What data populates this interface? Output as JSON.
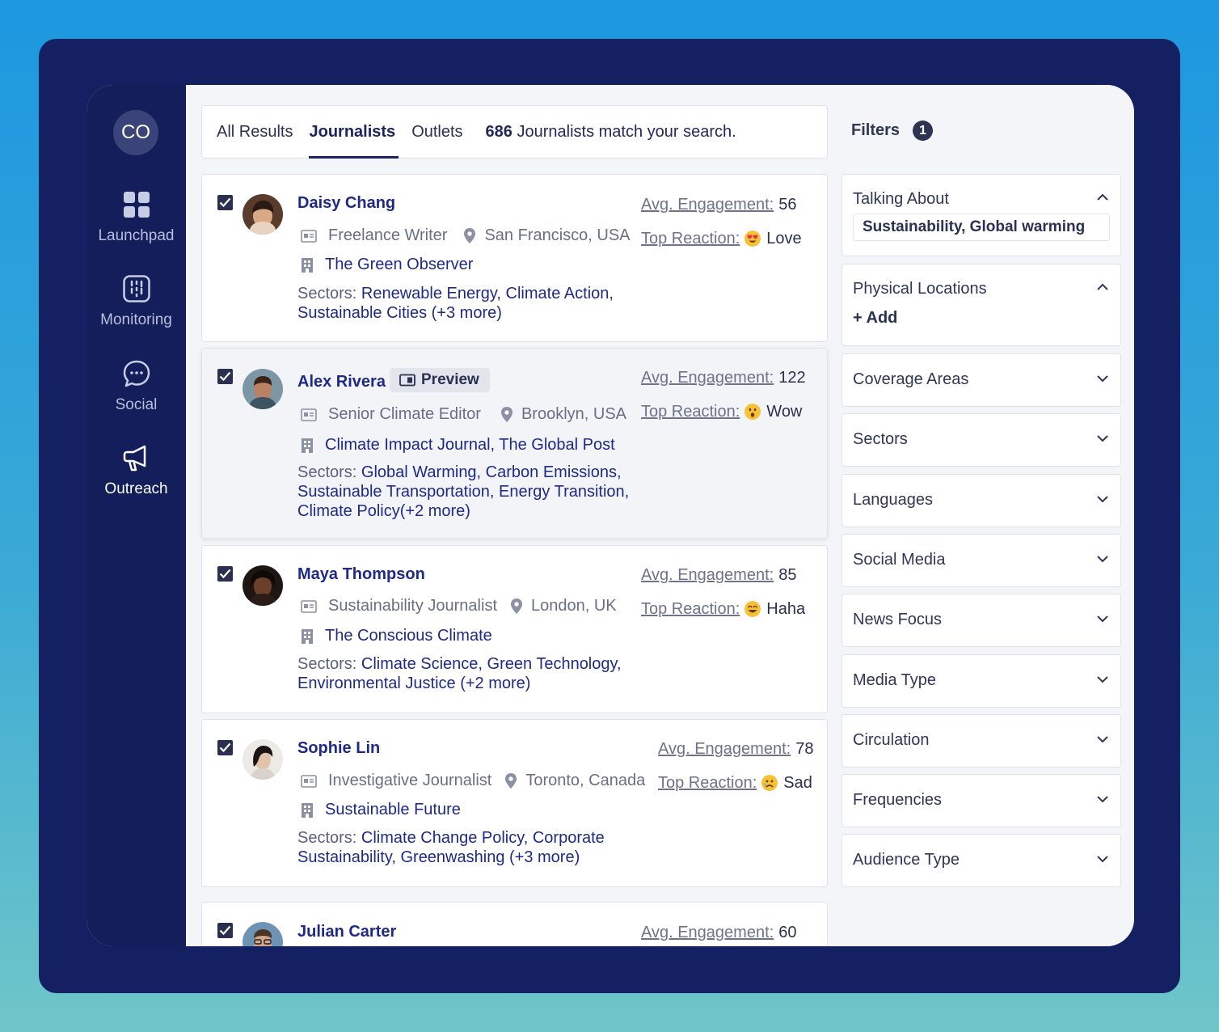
{
  "sidebar": {
    "avatar_initials": "CO",
    "items": [
      {
        "label": "Launchpad",
        "icon": "grid-icon"
      },
      {
        "label": "Monitoring",
        "icon": "monitoring-icon"
      },
      {
        "label": "Social",
        "icon": "chat-bubble-icon"
      },
      {
        "label": "Outreach",
        "icon": "megaphone-icon",
        "active": true
      }
    ]
  },
  "tabs": {
    "items": [
      "All Results",
      "Journalists",
      "Outlets"
    ],
    "active": "Journalists",
    "match_count": "686",
    "match_text": "Journalists match your search."
  },
  "metric_labels": {
    "engagement": "Avg. Engagement:",
    "reaction": "Top Reaction:",
    "sectors": "Sectors:"
  },
  "preview_label": "Preview",
  "journalists": [
    {
      "name": "Daisy Chang",
      "role": "Freelance Writer",
      "location": "San Francisco, USA",
      "outlet": "The Green Observer",
      "sectors_line1": "Renewable Energy, Climate Action,",
      "sectors_rest": "Sustainable Cities (+3 more)",
      "engagement": "56",
      "reaction": "Love",
      "checked": true
    },
    {
      "name": "Alex Rivera",
      "role": "Senior Climate Editor",
      "location": "Brooklyn, USA",
      "outlet": "Climate Impact Journal, The Global Post",
      "sectors_line1": "Global Warming, Carbon Emissions,",
      "sectors_rest": "Sustainable Transportation, Energy Transition, Climate Policy(+2 more)",
      "engagement": "122",
      "reaction": "Wow",
      "checked": true
    },
    {
      "name": "Maya Thompson",
      "role": "Sustainability Journalist",
      "location": "London, UK",
      "outlet": "The Conscious Climate",
      "sectors_line1": "Climate Science, Green Technology,",
      "sectors_rest": "Environmental Justice (+2 more)",
      "engagement": "85",
      "reaction": "Haha",
      "checked": true
    },
    {
      "name": "Sophie Lin",
      "role": "Investigative Journalist",
      "location": "Toronto, Canada",
      "outlet": "Sustainable Future",
      "sectors_line1": "Climate Change Policy, Corporate",
      "sectors_rest": "Sustainability, Greenwashing (+3 more)",
      "engagement": "78",
      "reaction": "Sad",
      "checked": true
    },
    {
      "name": "Julian Carter",
      "engagement": "60",
      "checked": true
    }
  ],
  "filters": {
    "title": "Filters",
    "count": "1",
    "talking_about": {
      "label": "Talking About",
      "value": "Sustainability, Global warming"
    },
    "physical_locations": {
      "label": "Physical Locations",
      "add": "+ Add"
    },
    "collapsed": [
      "Coverage Areas",
      "Sectors",
      "Languages",
      "Social Media",
      "News Focus",
      "Media Type",
      "Circulation",
      "Frequencies",
      "Audience Type"
    ]
  },
  "colors": {
    "frame": "#142062",
    "sidebar": "#141e5a",
    "accent_text": "#1e2a86",
    "panel_bg": "#f4f5f8"
  }
}
